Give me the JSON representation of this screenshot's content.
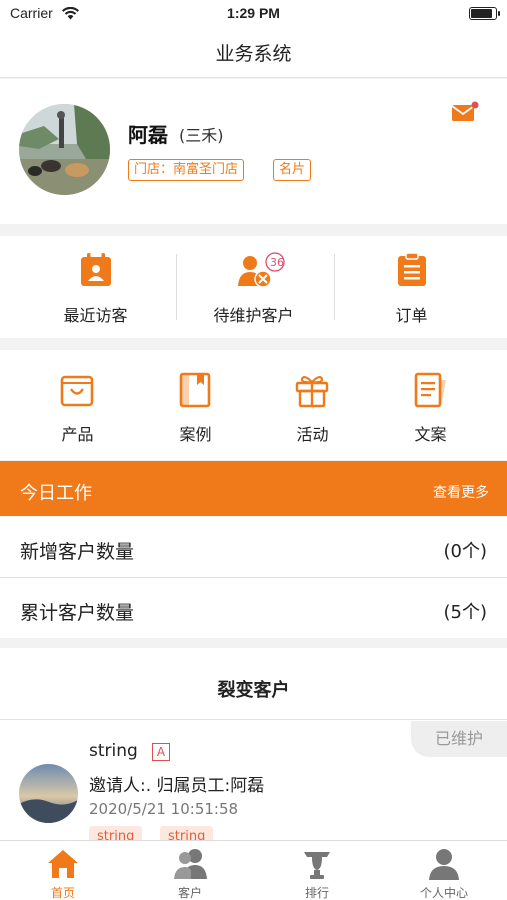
{
  "status_bar": {
    "carrier": "Carrier",
    "time": "1:29 PM",
    "battery_level": 0.9
  },
  "nav": {
    "title": "业务系统"
  },
  "profile": {
    "name": "阿磊",
    "alias": "(三禾)",
    "store_tag": "门店：南富圣门店",
    "card_tag": "名片",
    "mail_icon": "mail-icon",
    "has_unread": true
  },
  "quick_actions": [
    {
      "label": "最近访客",
      "icon": "calendar-user-icon"
    },
    {
      "label": "待维护客户",
      "icon": "user-tools-icon",
      "badge": "36"
    },
    {
      "label": "订单",
      "icon": "clipboard-icon"
    }
  ],
  "grid_menu": [
    {
      "label": "产品",
      "icon": "shopping-bag-icon"
    },
    {
      "label": "案例",
      "icon": "book-icon"
    },
    {
      "label": "活动",
      "icon": "gift-icon"
    },
    {
      "label": "文案",
      "icon": "document-icon"
    }
  ],
  "today_work": {
    "title": "今日工作",
    "more": "查看更多",
    "rows": [
      {
        "label": "新增客户数量",
        "value": "(0个)"
      },
      {
        "label": "累计客户数量",
        "value": "(5个)"
      }
    ]
  },
  "fission": {
    "title": "裂变客户",
    "customer": {
      "name": "string",
      "mark": "A",
      "status": "已维护",
      "info": "邀请人:.  归属员工:阿磊",
      "time": "2020/5/21 10:51:58",
      "tags": [
        "string",
        "string"
      ]
    }
  },
  "tabbar": [
    {
      "label": "首页",
      "icon": "home-icon",
      "active": true
    },
    {
      "label": "客户",
      "icon": "users-icon",
      "active": false
    },
    {
      "label": "排行",
      "icon": "trophy-icon",
      "active": false
    },
    {
      "label": "个人中心",
      "icon": "person-icon",
      "active": false
    }
  ],
  "colors": {
    "accent": "#f07a1a",
    "badge": "#e05070",
    "background": "#f2f2f2"
  }
}
